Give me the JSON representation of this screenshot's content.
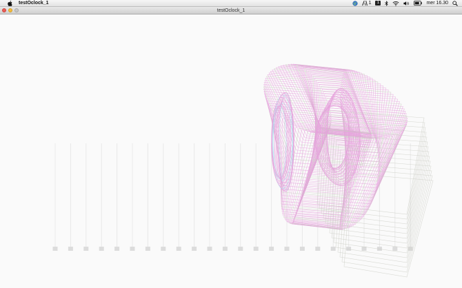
{
  "menubar": {
    "app_name": "testOclock_1",
    "apple_icon": "apple-logo-icon",
    "status": {
      "globe_icon": "globe-icon",
      "adobe_label": "1",
      "badge_label": "1",
      "bluetooth_icon": "bluetooth-icon",
      "wifi_icon": "wifi-icon",
      "volume_icon": "volume-icon",
      "battery_icon": "battery-icon",
      "clock": "mer 16.30",
      "search_icon": "spotlight-search-icon"
    }
  },
  "window": {
    "title": "testOclock_1",
    "close_icon": "close-icon",
    "minimize_icon": "minimize-icon",
    "zoom_icon": "zoom-icon"
  },
  "sketch": {
    "bar_count": 24,
    "colors": {
      "background": "#fafafa",
      "bar": "#e9e9e9",
      "bar_base": "#dcdcdc",
      "pink": "#e6a2dc",
      "gray": "#c9cbc2",
      "cyan": "#a9dced"
    }
  }
}
